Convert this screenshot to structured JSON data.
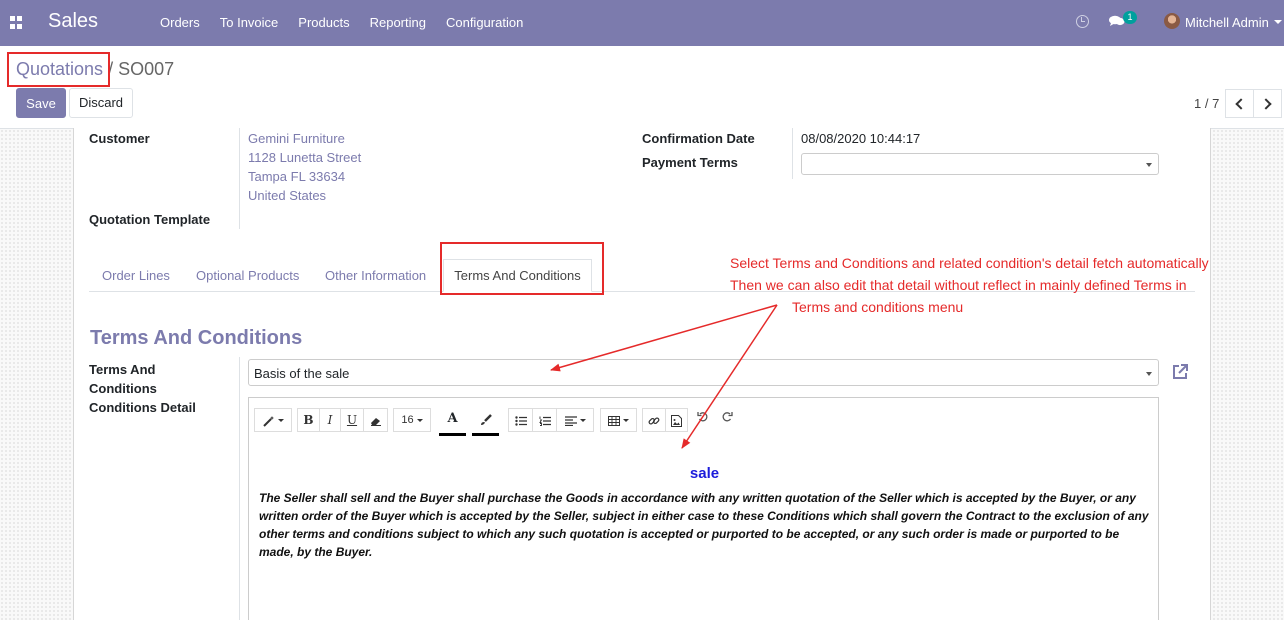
{
  "navbar": {
    "app_name": "Sales",
    "menu": [
      "Orders",
      "To Invoice",
      "Products",
      "Reporting",
      "Configuration"
    ],
    "chat_count": "1",
    "user_name": "Mitchell Admin",
    "color": "#7c7bad"
  },
  "control_panel": {
    "breadcrumb_parent": "Quotations",
    "breadcrumb_separator": "/",
    "breadcrumb_current": "SO007",
    "save_label": "Save",
    "discard_label": "Discard",
    "pager": "1 / 7"
  },
  "form": {
    "customer_label": "Customer",
    "customer_address": [
      "Gemini Furniture",
      "1128 Lunetta Street",
      "Tampa FL 33634",
      "United States"
    ],
    "quotation_template_label": "Quotation Template",
    "confirmation_date_label": "Confirmation Date",
    "confirmation_date_value": "08/08/2020 10:44:17",
    "payment_terms_label": "Payment Terms",
    "payment_terms_value": ""
  },
  "tabs": [
    {
      "label": "Order Lines",
      "active": false
    },
    {
      "label": "Optional Products",
      "active": false
    },
    {
      "label": "Other Information",
      "active": false
    },
    {
      "label": "Terms And Conditions",
      "active": true
    }
  ],
  "annotation": {
    "line1": "Select Terms and Conditions and related condition's detail fetch automatically",
    "line2": "Then we can also edit that detail without reflect in mainly defined Terms in",
    "line3": "Terms and conditions menu",
    "color": "#e52a2a"
  },
  "terms_section": {
    "title": "Terms And Conditions",
    "field_label_line1": "Terms And",
    "field_label_line2": "Conditions",
    "detail_label": "Conditions Detail",
    "selected_term": "Basis of the sale"
  },
  "editor": {
    "font_size": "16",
    "heading": "sale",
    "heading_color": "#1c1cdb",
    "body": "The Seller shall sell and the Buyer shall purchase the Goods in accordance with any written quotation of the Seller which is accepted by the Buyer, or any written order of the Buyer which is accepted by the Seller, subject in either case to these Conditions which shall govern the Contract to the exclusion of any other terms and conditions subject to which any such quotation is accepted or purported to be accepted, or any such order is made or purported to be made, by the Buyer.",
    "toolbar_icons": [
      "magic-wand-icon",
      "bold-icon",
      "italic-icon",
      "underline-icon",
      "eraser-icon",
      "font-size-dropdown",
      "text-color-icon",
      "fill-color-icon",
      "unordered-list-icon",
      "ordered-list-icon",
      "align-icon",
      "table-icon",
      "link-icon",
      "image-icon",
      "undo-icon",
      "redo-icon"
    ]
  }
}
